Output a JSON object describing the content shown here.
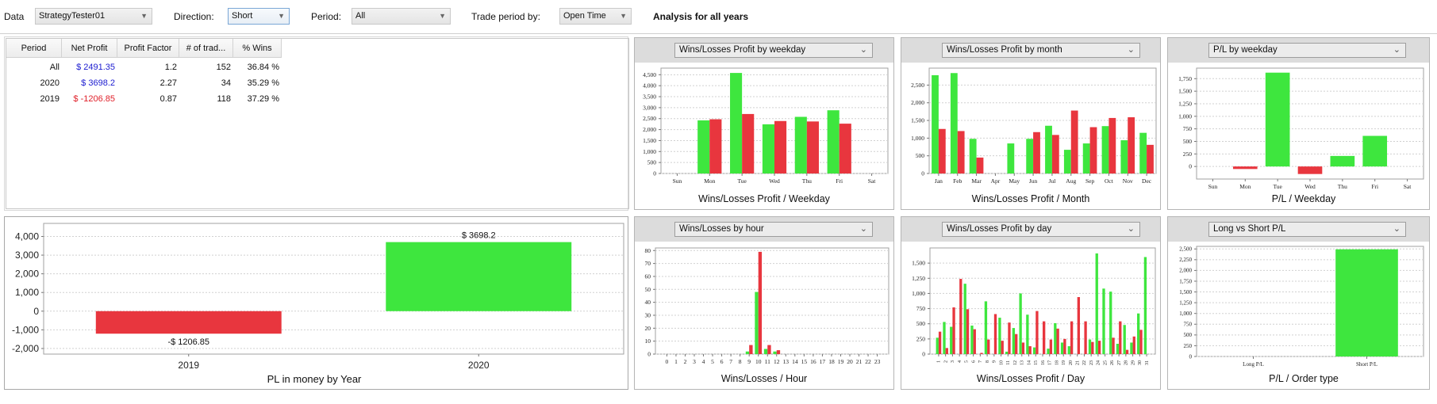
{
  "toolbar": {
    "data_label": "Data",
    "data_value": "StrategyTester01",
    "direction_label": "Direction:",
    "direction_value": "Short",
    "period_label": "Period:",
    "period_value": "All",
    "trade_period_label": "Trade period by:",
    "trade_period_value": "Open Time",
    "analysis_label": "Analysis for all years",
    "dropdown_arrow": "▼"
  },
  "summary_table": {
    "columns": [
      "Period",
      "Net Profit",
      "Profit Factor",
      "# of trad...",
      "% Wins"
    ],
    "rows": [
      {
        "period": "All",
        "net_profit": "$ 2491.35",
        "profit_factor": "1.2",
        "trades": "152",
        "wins": "36.84 %",
        "profit_sign": "positive"
      },
      {
        "period": "2020",
        "net_profit": "$ 3698.2",
        "profit_factor": "2.27",
        "trades": "34",
        "wins": "35.29 %",
        "profit_sign": "positive"
      },
      {
        "period": "2019",
        "net_profit": "$ -1206.85",
        "profit_factor": "0.87",
        "trades": "118",
        "wins": "37.29 %",
        "profit_sign": "negative"
      }
    ]
  },
  "colors": {
    "win": "#3ee63e",
    "loss": "#e8363e",
    "positive_text": "#1b1bd0",
    "negative_text": "#e0202a"
  },
  "chart_data": [
    {
      "id": "year",
      "type": "bar",
      "title": "PL in money by Year",
      "xlabel": "PL in money by Year",
      "categories": [
        "2019",
        "2020"
      ],
      "values": [
        -1206.85,
        3698.2
      ],
      "data_labels": [
        "-$ 1206.85",
        "$ 3698.2"
      ],
      "ylim": [
        -2300,
        4700
      ],
      "yticks": [
        -2000,
        -1000,
        0,
        1000,
        2000,
        3000,
        4000
      ],
      "ytick_labels": [
        "-2,000",
        "-1,000",
        "0",
        "1,000",
        "2,000",
        "3,000",
        "4,000"
      ],
      "grid": true
    },
    {
      "id": "weekday",
      "type": "bar",
      "selector": "Wins/Losses Profit by weekday",
      "xlabel": "Wins/Losses Profit / Weekday",
      "categories": [
        "Sun",
        "Mon",
        "Tue",
        "Wed",
        "Thu",
        "Fri",
        "Sat"
      ],
      "series": [
        {
          "name": "Wins",
          "values": [
            0,
            2420,
            4580,
            2240,
            2580,
            2880,
            0
          ]
        },
        {
          "name": "Losses",
          "values": [
            0,
            2470,
            2710,
            2390,
            2370,
            2270,
            0
          ]
        }
      ],
      "ylim": [
        0,
        4800
      ],
      "yticks": [
        0,
        500,
        1000,
        1500,
        2000,
        2500,
        3000,
        3500,
        4000,
        4500
      ],
      "ytick_labels": [
        "0",
        "500",
        "1,000",
        "1,500",
        "2,000",
        "2,500",
        "3,000",
        "3,500",
        "4,000",
        "4,500"
      ],
      "grid": true
    },
    {
      "id": "month",
      "type": "bar",
      "selector": "Wins/Losses Profit by month",
      "xlabel": "Wins/Losses Profit / Month",
      "categories": [
        "Jan",
        "Feb",
        "Mar",
        "Apr",
        "May",
        "Jun",
        "Jul",
        "Aug",
        "Sep",
        "Oct",
        "Nov",
        "Dec"
      ],
      "series": [
        {
          "name": "Wins",
          "values": [
            2780,
            2840,
            980,
            0,
            850,
            980,
            1350,
            670,
            850,
            1340,
            940,
            1150
          ]
        },
        {
          "name": "Losses",
          "values": [
            1260,
            1200,
            450,
            0,
            0,
            1170,
            1090,
            1780,
            1310,
            1570,
            1590,
            810
          ]
        }
      ],
      "ylim": [
        0,
        2980
      ],
      "yticks": [
        0,
        500,
        1000,
        1500,
        2000,
        2500
      ],
      "ytick_labels": [
        "0",
        "500",
        "1,000",
        "1,500",
        "2,000",
        "2,500"
      ],
      "grid": true
    },
    {
      "id": "plweekday",
      "type": "bar",
      "selector": "P/L by weekday",
      "xlabel": "P/L / Weekday",
      "categories": [
        "Sun",
        "Mon",
        "Tue",
        "Wed",
        "Thu",
        "Fri",
        "Sat"
      ],
      "values": [
        0,
        -50,
        1870,
        -150,
        210,
        610,
        0
      ],
      "ylim": [
        -250,
        1960
      ],
      "yticks": [
        0,
        250,
        500,
        750,
        1000,
        1250,
        1500,
        1750
      ],
      "ytick_labels": [
        "0",
        "250",
        "500",
        "750",
        "1,000",
        "1,250",
        "1,500",
        "1,750"
      ],
      "grid": true
    },
    {
      "id": "hour",
      "type": "bar",
      "selector": "Wins/Losses by hour",
      "xlabel": "Wins/Losses / Hour",
      "categories": [
        "0",
        "1",
        "2",
        "3",
        "4",
        "5",
        "6",
        "7",
        "8",
        "9",
        "10",
        "11",
        "12",
        "13",
        "14",
        "15",
        "16",
        "17",
        "18",
        "19",
        "20",
        "21",
        "22",
        "23"
      ],
      "series": [
        {
          "name": "Wins",
          "values": [
            0,
            0,
            0,
            0,
            0,
            0,
            0,
            0,
            0,
            2,
            48,
            4,
            2,
            0,
            0,
            0,
            0,
            0,
            0,
            0,
            0,
            0,
            0,
            0
          ]
        },
        {
          "name": "Losses",
          "values": [
            0,
            0,
            0,
            0,
            0,
            0,
            0,
            0,
            0,
            7,
            79,
            7,
            3,
            0,
            0,
            0,
            0,
            0,
            0,
            0,
            0,
            0,
            0,
            0
          ]
        }
      ],
      "ylim": [
        0,
        82
      ],
      "yticks": [
        0,
        10,
        20,
        30,
        40,
        50,
        60,
        70,
        80
      ],
      "ytick_labels": [
        "0",
        "10",
        "20",
        "30",
        "40",
        "50",
        "60",
        "70",
        "80"
      ],
      "grid": true
    },
    {
      "id": "day",
      "type": "bar",
      "selector": "Wins/Losses Profit by day",
      "xlabel": "Wins/Losses Profit / Day",
      "categories": [
        "1",
        "2",
        "3",
        "4",
        "5",
        "6",
        "7",
        "8",
        "9",
        "10",
        "11",
        "12",
        "13",
        "14",
        "15",
        "16",
        "17",
        "18",
        "19",
        "20",
        "21",
        "22",
        "23",
        "24",
        "25",
        "26",
        "27",
        "28",
        "29",
        "30",
        "31"
      ],
      "series": [
        {
          "name": "Wins",
          "values": [
            270,
            530,
            450,
            0,
            1160,
            470,
            0,
            870,
            0,
            600,
            40,
            430,
            1000,
            650,
            110,
            0,
            90,
            510,
            190,
            130,
            0,
            0,
            240,
            1660,
            1080,
            1030,
            170,
            480,
            190,
            670,
            1600
          ]
        },
        {
          "name": "Losses",
          "values": [
            370,
            100,
            770,
            1240,
            740,
            410,
            20,
            240,
            660,
            220,
            520,
            330,
            190,
            130,
            710,
            540,
            240,
            420,
            250,
            540,
            940,
            540,
            200,
            220,
            0,
            270,
            540,
            70,
            290,
            400,
            0
          ]
        }
      ],
      "ylim": [
        0,
        1750
      ],
      "yticks": [
        0,
        250,
        500,
        750,
        1000,
        1250,
        1500
      ],
      "ytick_labels": [
        "0",
        "250",
        "500",
        "750",
        "1,000",
        "1,250",
        "1,500"
      ],
      "grid": true
    },
    {
      "id": "longshort",
      "type": "bar",
      "selector": "Long vs Short P/L",
      "xlabel": "P/L / Order type",
      "categories": [
        "Long P/L",
        "Short P/L"
      ],
      "values": [
        0,
        2491.35
      ],
      "ylim": [
        0,
        2560
      ],
      "yticks": [
        0,
        250,
        500,
        750,
        1000,
        1250,
        1500,
        1750,
        2000,
        2250,
        2500
      ],
      "ytick_labels": [
        "0",
        "250",
        "500",
        "750",
        "1,000",
        "1,250",
        "1,500",
        "1,750",
        "2,000",
        "2,250",
        "2,500"
      ],
      "grid": true
    }
  ]
}
